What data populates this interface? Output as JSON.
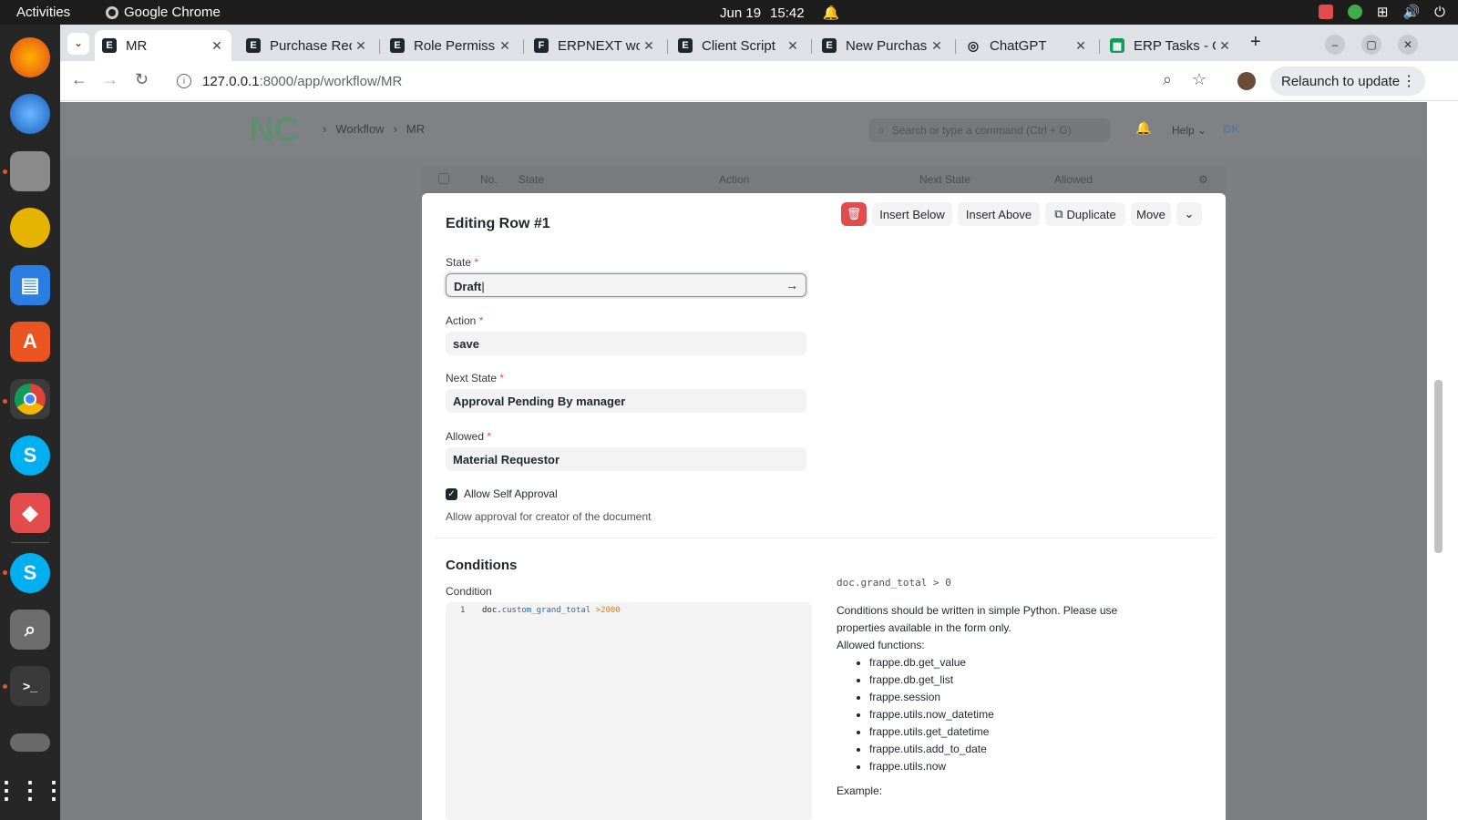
{
  "os": {
    "activities": "Activities",
    "app_name": "Google Chrome",
    "date": "Jun 19",
    "time": "15:42"
  },
  "browser": {
    "tabs": [
      {
        "label": "MR",
        "favicon": "E"
      },
      {
        "label": "Purchase Req",
        "favicon": "E"
      },
      {
        "label": "Role Permissi",
        "favicon": "E"
      },
      {
        "label": "ERPNEXT wo",
        "favicon": "F"
      },
      {
        "label": "Client Script",
        "favicon": "E"
      },
      {
        "label": "New Purchas",
        "favicon": "E"
      },
      {
        "label": "ChatGPT",
        "favicon": "◎"
      },
      {
        "label": "ERP Tasks - G",
        "favicon": "▦"
      }
    ],
    "url_host": "127.0.0.1",
    "url_path": ":8000/app/workflow/MR",
    "relaunch_label": "Relaunch to update"
  },
  "app": {
    "breadcrumbs": [
      "Workflow",
      "MR"
    ],
    "search_placeholder": "Search or type a command (Ctrl + G)",
    "help_label": "Help",
    "avatar_initials": "DK",
    "grid_columns": [
      "No.",
      "State",
      "Action",
      "Next State",
      "Allowed"
    ]
  },
  "editor": {
    "title": "Editing Row #1",
    "buttons": {
      "insert_below": "Insert Below",
      "insert_above": "Insert Above",
      "duplicate": "Duplicate",
      "move": "Move"
    },
    "fields": {
      "state_label": "State",
      "state_value": "Draft",
      "action_label": "Action",
      "action_value": "save",
      "next_state_label": "Next State",
      "next_state_value": "Approval Pending By manager",
      "allowed_label": "Allowed",
      "allowed_value": "Material Requestor"
    },
    "self_approval": {
      "label": "Allow Self Approval",
      "checked": true,
      "description": "Allow approval for creator of the document"
    },
    "conditions": {
      "section_title": "Conditions",
      "condition_label": "Condition",
      "line_no": "1",
      "code_obj": "doc.",
      "code_prop": "custom_grand_total",
      "code_op": " >",
      "code_num": "2000",
      "example_expr": "doc.grand_total > 0",
      "help_text": "Conditions should be written in simple Python. Please use properties available in the form only.",
      "allowed_functions_label": "Allowed functions:",
      "functions": [
        "frappe.db.get_value",
        "frappe.db.get_list",
        "frappe.session",
        "frappe.utils.now_datetime",
        "frappe.utils.get_datetime",
        "frappe.utils.add_to_date",
        "frappe.utils.now"
      ],
      "example_label": "Example:"
    }
  }
}
